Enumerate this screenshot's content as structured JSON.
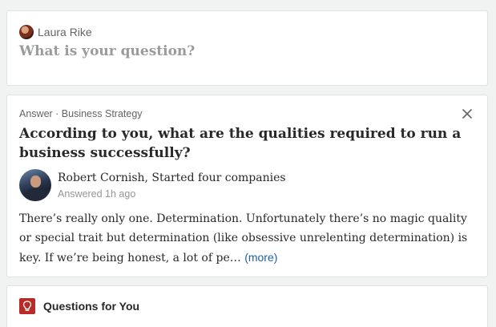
{
  "ask": {
    "username": "Laura Rike",
    "prompt": "What is your question?"
  },
  "answer": {
    "meta": "Answer · Business Strategy",
    "close_icon": "close-icon",
    "question": "According to you, what are the qualities required to run a business successfully?",
    "author": "Robert Cornish, Started four companies",
    "time": "Answered 1h ago",
    "body": "There’s really only one. Determination. Unfortunately there’s no magic quality or special trait but determination (like obsessive unrelenting determination) is key. If we’re being honest, a lot of pe… ",
    "more": "(more)"
  },
  "qfy": {
    "title": "Questions for You",
    "icon": "lightbulb-icon"
  },
  "colors": {
    "brand_red": "#b92b27",
    "link_blue": "#195faa"
  }
}
